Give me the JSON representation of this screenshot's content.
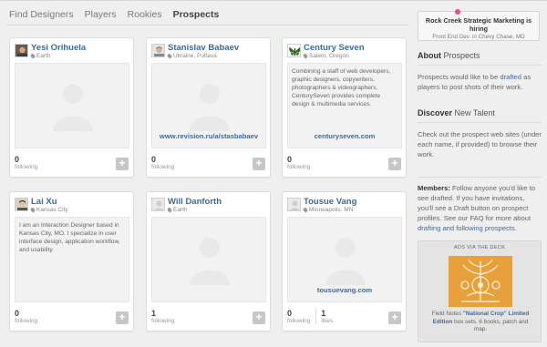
{
  "nav": {
    "tabs": [
      {
        "label": "Find Designers"
      },
      {
        "label": "Players"
      },
      {
        "label": "Rookies"
      },
      {
        "label": "Prospects"
      }
    ],
    "active": "Prospects"
  },
  "cards": [
    {
      "name": "Yesi Orihuela",
      "location": "Earth",
      "description": "",
      "url": "",
      "stats": [
        {
          "num": "0",
          "label": "following"
        }
      ]
    },
    {
      "name": "Stanislav Babaev",
      "location": "Ukraine, Poltava",
      "description": "",
      "url": "www.revision.ru/a/stasbabaev",
      "stats": [
        {
          "num": "0",
          "label": "following"
        }
      ]
    },
    {
      "name": "Century Seven",
      "location": "Salem, Oregon",
      "description": "Combining a staff of web developers, graphic designers, copywriters, photographers & videographers, CenturySeven provides complete design & multimedia services.",
      "url": "centuryseven.com",
      "stats": [
        {
          "num": "0",
          "label": "following"
        }
      ]
    },
    {
      "name": "Lai Xu",
      "location": "Kansas City",
      "description": "I am an Interaction Designer based in Kansas City, MO. I specialize in user interface design, application workflow, and usability.",
      "url": "",
      "stats": [
        {
          "num": "0",
          "label": "following"
        }
      ]
    },
    {
      "name": "Will Danforth",
      "location": "Earth",
      "description": "",
      "url": "",
      "stats": [
        {
          "num": "1",
          "label": "following"
        }
      ]
    },
    {
      "name": "Tousue Vang",
      "location": "Minneapolis, MN",
      "description": "",
      "url": "tousuevang.com",
      "stats": [
        {
          "num": "0",
          "label": "following"
        },
        {
          "num": "1",
          "label": "likes"
        }
      ]
    }
  ],
  "ad_top": {
    "title": "Rock Creek Strategic Marketing is hiring",
    "subtitle": "Front End Dev. in Chevy Chase, MD"
  },
  "about": {
    "heading": "About",
    "heading_rest": "Prospects",
    "text_before": "Prospects would like to be",
    "link": "drafted",
    "text_after": "as players to post shots of their work."
  },
  "discover": {
    "heading": "Discover",
    "heading_rest": "New Talent",
    "text": "Check out the prospect web sites (under each name, if provided) to browse their work."
  },
  "members": {
    "label": "Members:",
    "text": "Follow anyone you'd like to see drafted. If you have invitations, you'll see a Draft button on prospect profiles. See our FAQ for more about",
    "link": "drafting and following prospects"
  },
  "deck": {
    "header": "ADS VIA THE DECK",
    "caption_before": "Field Notes",
    "caption_link": "\"National Crop\" Limited Edition",
    "caption_after": "box sets. 6 books, patch and map."
  },
  "colors": {
    "link": "#3f6a9a",
    "accent": "#ea4c89",
    "ad_image": "#e8a03a"
  }
}
